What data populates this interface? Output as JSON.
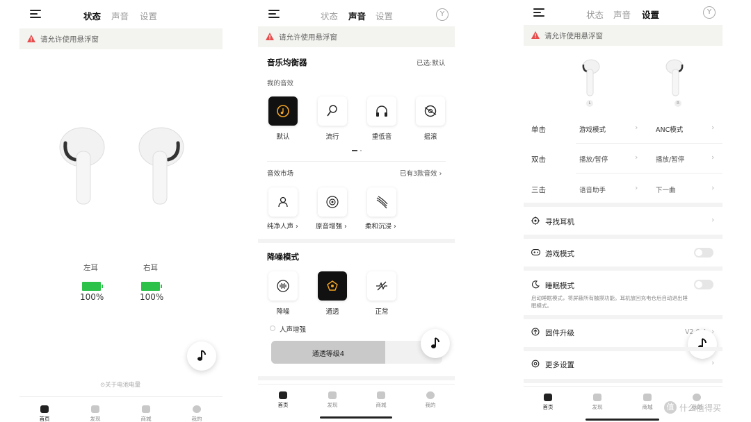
{
  "status_panel": {
    "tabs": [
      "状态",
      "声音",
      "设置"
    ],
    "warning": "请允许使用悬浮窗",
    "left_ear_label": "左耳",
    "right_ear_label": "右耳",
    "left_battery": "100%",
    "right_battery": "100%",
    "left_battery_level": 1.0,
    "right_battery_level": 1.0,
    "battery_note": "⊙关于电池电量",
    "nav": [
      "首页",
      "发现",
      "商城",
      "我的"
    ]
  },
  "sound_panel": {
    "tabs": [
      "状态",
      "声音",
      "设置"
    ],
    "warning": "请允许使用悬浮窗",
    "eq_title": "音乐均衡器",
    "eq_selected": "已选:默认",
    "my_effects_label": "我的音效",
    "effects": [
      "默认",
      "流行",
      "重低音",
      "摇滚"
    ],
    "market_title": "音效市场",
    "market_count": "已有3款音效",
    "market_items": [
      "纯净人声",
      "原音增强",
      "柔和沉浸"
    ],
    "anc_title": "降噪模式",
    "anc_modes": [
      "降噪",
      "通透",
      "正常"
    ],
    "voice_boost": "人声增强",
    "transparency_level": "通透等级4",
    "nav": [
      "首页",
      "发现",
      "商城",
      "我的"
    ]
  },
  "settings_panel": {
    "tabs": [
      "状态",
      "声音",
      "设置"
    ],
    "warning": "请允许使用悬浮窗",
    "left_tag": "L",
    "right_tag": "R",
    "gestures": [
      {
        "name": "单击",
        "left": "游戏模式",
        "right": "ANC模式"
      },
      {
        "name": "双击",
        "left": "播放/暂停",
        "right": "播放/暂停"
      },
      {
        "name": "三击",
        "left": "语音助手",
        "right": "下一曲"
      }
    ],
    "find_earbuds": "寻找耳机",
    "game_mode": "游戏模式",
    "sleep_mode": "睡眠模式",
    "sleep_desc_1": "启动睡眠模式，将屏蔽所有触摸功能。耳机放回充电仓后自动退出睡",
    "sleep_desc_2": "眠模式。",
    "firmware": "固件升级",
    "firmware_version": "V2.0.4",
    "more_settings": "更多设置",
    "nav": [
      "首页",
      "发现",
      "商城",
      "我的"
    ]
  },
  "watermark": "值 什么值得买",
  "colors": {
    "battery": "#2cc24a",
    "accent": "#f5a623",
    "warning_icon": "#e84d4d"
  }
}
